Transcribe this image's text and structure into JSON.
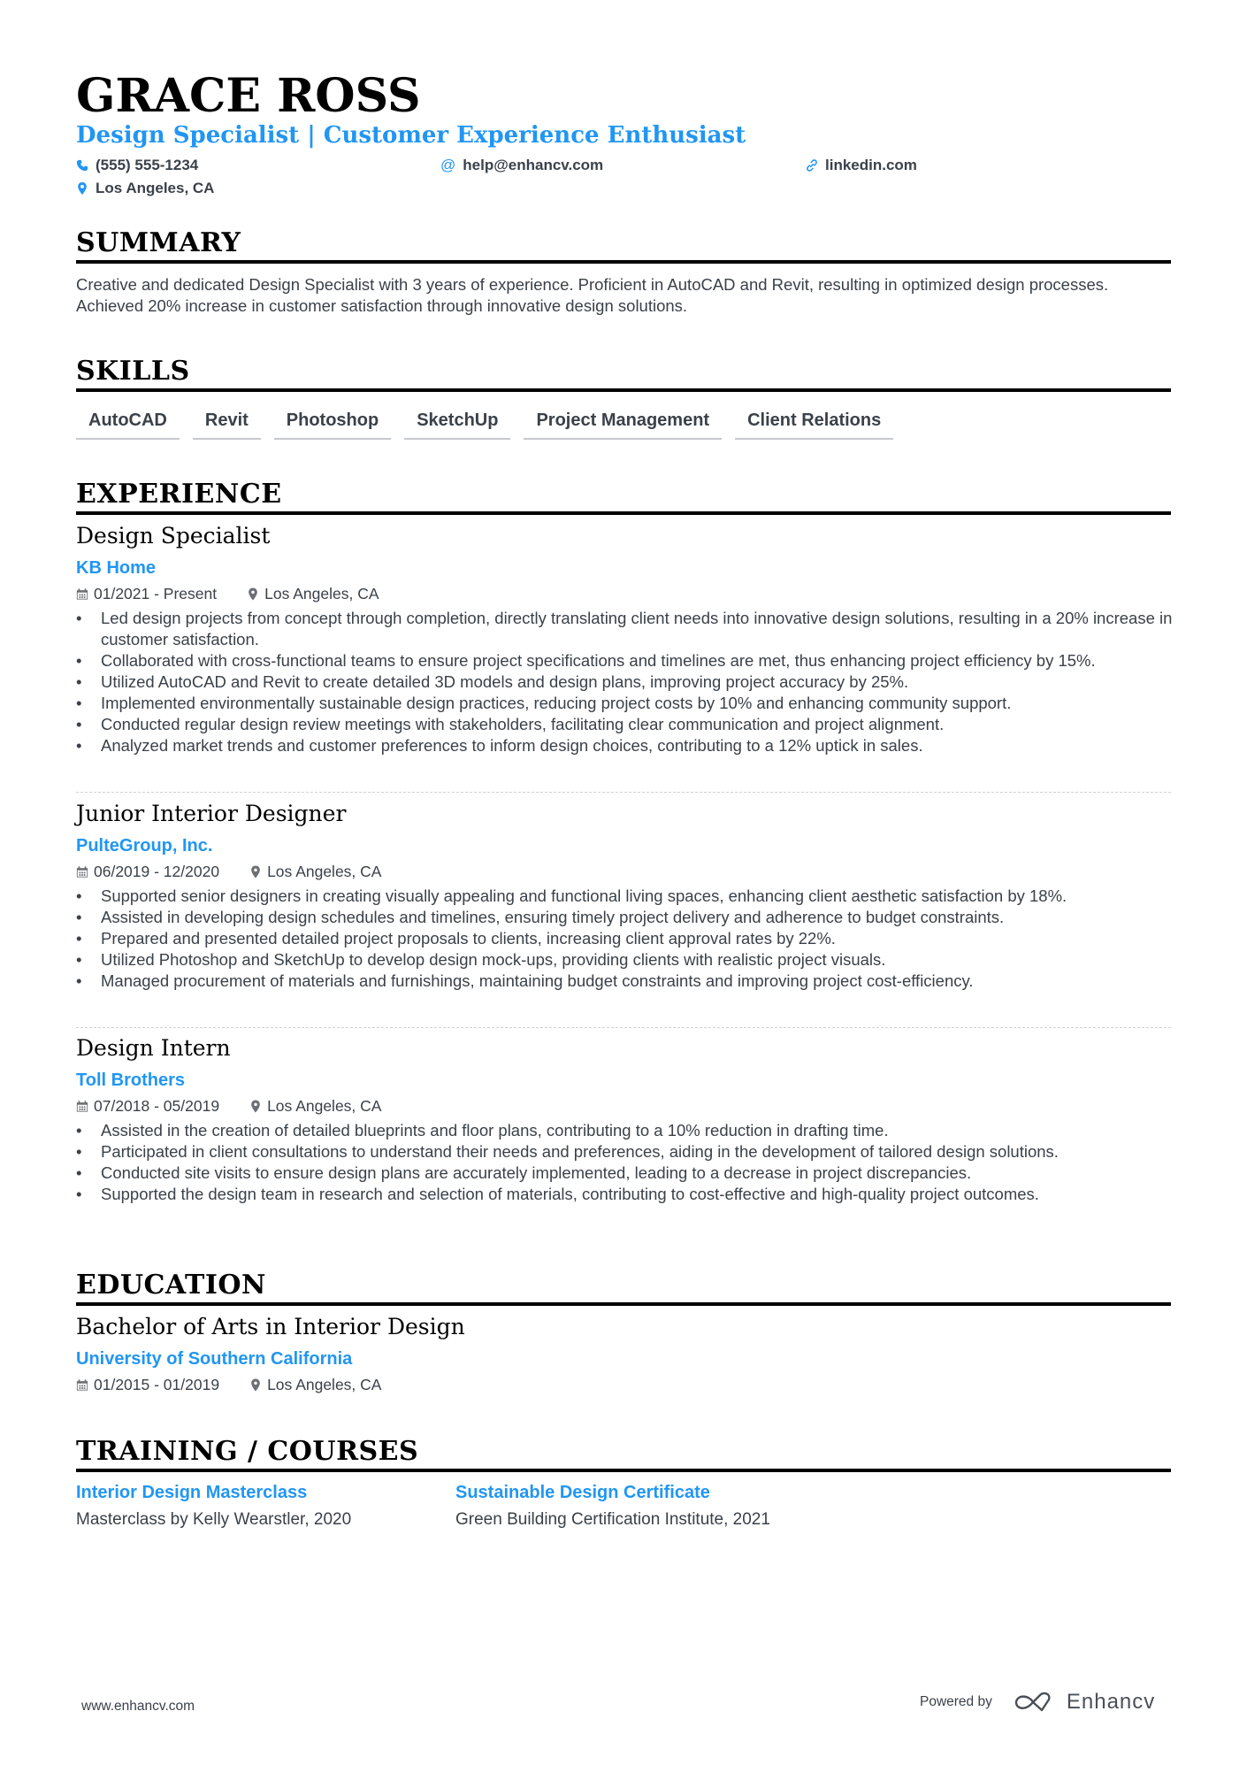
{
  "header": {
    "name": "GRACE ROSS",
    "title": "Design Specialist | Customer Experience Enthusiast",
    "phone": "(555) 555-1234",
    "email": "help@enhancv.com",
    "linkedin": "linkedin.com",
    "location": "Los Angeles, CA",
    "accent_color": "#2196f3"
  },
  "summary": {
    "heading": "SUMMARY",
    "text": "Creative and dedicated Design Specialist with 3 years of experience. Proficient in AutoCAD and Revit, resulting in optimized design processes. Achieved 20% increase in customer satisfaction through innovative design solutions."
  },
  "skills": {
    "heading": "SKILLS",
    "items": [
      "AutoCAD",
      "Revit",
      "Photoshop",
      "SketchUp",
      "Project Management",
      "Client Relations"
    ]
  },
  "experience": {
    "heading": "EXPERIENCE",
    "jobs": [
      {
        "title": "Design Specialist",
        "company": "KB Home",
        "dates": "01/2021 - Present",
        "location": "Los Angeles, CA",
        "bullets": [
          "Led design projects from concept through completion, directly translating client needs into innovative design solutions, resulting in a 20% increase in customer satisfaction.",
          "Collaborated with cross-functional teams to ensure project specifications and timelines are met, thus enhancing project efficiency by 15%.",
          "Utilized AutoCAD and Revit to create detailed 3D models and design plans, improving project accuracy by 25%.",
          "Implemented environmentally sustainable design practices, reducing project costs by 10% and enhancing community support.",
          "Conducted regular design review meetings with stakeholders, facilitating clear communication and project alignment.",
          "Analyzed market trends and customer preferences to inform design choices, contributing to a 12% uptick in sales."
        ]
      },
      {
        "title": "Junior Interior Designer",
        "company": "PulteGroup, Inc.",
        "dates": "06/2019 - 12/2020",
        "location": "Los Angeles, CA",
        "bullets": [
          "Supported senior designers in creating visually appealing and functional living spaces, enhancing client aesthetic satisfaction by 18%.",
          "Assisted in developing design schedules and timelines, ensuring timely project delivery and adherence to budget constraints.",
          "Prepared and presented detailed project proposals to clients, increasing client approval rates by 22%.",
          "Utilized Photoshop and SketchUp to develop design mock-ups, providing clients with realistic project visuals.",
          "Managed procurement of materials and furnishings, maintaining budget constraints and improving project cost-efficiency."
        ]
      },
      {
        "title": "Design Intern",
        "company": "Toll Brothers",
        "dates": "07/2018 - 05/2019",
        "location": "Los Angeles, CA",
        "bullets": [
          "Assisted in the creation of detailed blueprints and floor plans, contributing to a 10% reduction in drafting time.",
          "Participated in client consultations to understand their needs and preferences, aiding in the development of tailored design solutions.",
          "Conducted site visits to ensure design plans are accurately implemented, leading to a decrease in project discrepancies.",
          "Supported the design team in research and selection of materials, contributing to cost-effective and high-quality project outcomes."
        ]
      }
    ]
  },
  "education": {
    "heading": "EDUCATION",
    "degree": "Bachelor of Arts in Interior Design",
    "school": "University of Southern California",
    "dates": "01/2015 - 01/2019",
    "location": "Los Angeles, CA"
  },
  "training": {
    "heading": "TRAINING / COURSES",
    "courses": [
      {
        "title": "Interior Design Masterclass",
        "description": "Masterclass by Kelly Wearstler, 2020"
      },
      {
        "title": "Sustainable Design Certificate",
        "description": "Green Building Certification Institute, 2021"
      }
    ]
  },
  "footer": {
    "website": "www.enhancv.com",
    "powered_by": "Powered by",
    "brand": "Enhancv"
  }
}
